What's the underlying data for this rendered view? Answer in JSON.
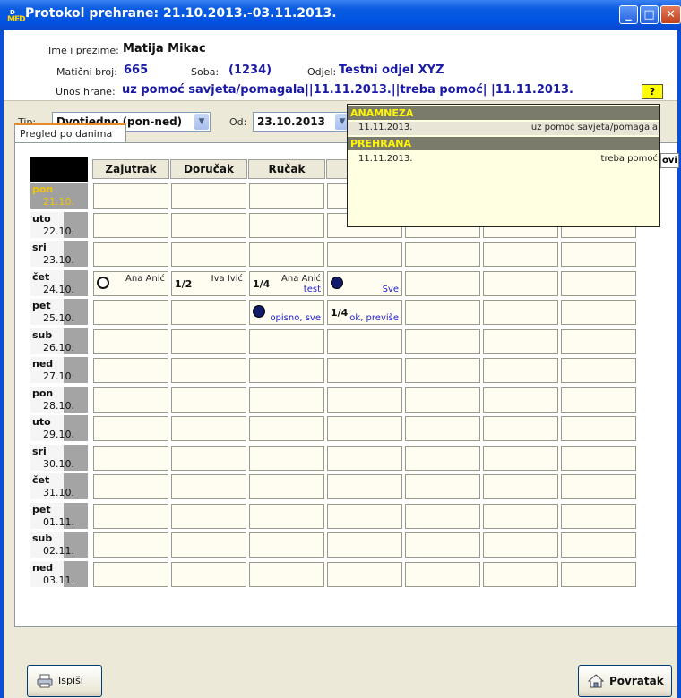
{
  "window": {
    "title": "Protokol prehrane: 21.10.2013.-03.11.2013.",
    "icon_top": "D",
    "icon_bottom": "MED"
  },
  "header": {
    "name_label": "Ime i prezime:",
    "name_value": "Matija Mikac",
    "mbr_label": "Matični broj:",
    "mbr_value": "665",
    "soba_label": "Soba:",
    "soba_value": "(1234)",
    "odjel_label": "Odjel:",
    "odjel_value": "Testni odjel XYZ",
    "unos_label": "Unos hrane:",
    "unos_value": "uz pomoć savjeta/pomagala||11.11.2013.||treba pomoć| |11.11.2013.",
    "help_label": "?"
  },
  "filters": {
    "tip_label": "Tip:",
    "tip_value": "Dvotjedno (pon-ned)",
    "od_label": "Od:",
    "od_value": "23.10.2013"
  },
  "tab": {
    "label": "Pregled po danima"
  },
  "columns": [
    "Zajutrak",
    "Doručak",
    "Ručak",
    "",
    "",
    "",
    ""
  ],
  "days": [
    {
      "name": "pon",
      "date": "21.10.",
      "today": true
    },
    {
      "name": "uto",
      "date": "22.10."
    },
    {
      "name": "sri",
      "date": "23.10."
    },
    {
      "name": "čet",
      "date": "24.10."
    },
    {
      "name": "pet",
      "date": "25.10."
    },
    {
      "name": "sub",
      "date": "26.10."
    },
    {
      "name": "ned",
      "date": "27.10."
    },
    {
      "name": "pon",
      "date": "28.10."
    },
    {
      "name": "uto",
      "date": "29.10."
    },
    {
      "name": "sri",
      "date": "30.10."
    },
    {
      "name": "čet",
      "date": "31.10."
    },
    {
      "name": "pet",
      "date": "01.11."
    },
    {
      "name": "sub",
      "date": "02.11."
    },
    {
      "name": "ned",
      "date": "03.11."
    }
  ],
  "cells": {
    "r3c1": {
      "mark": "empty-circle",
      "who": "Ana Anić"
    },
    "r3c2": {
      "frac": "1/2",
      "who": "Iva Ivić"
    },
    "r3c3": {
      "frac": "1/4",
      "who": "Ana Anić",
      "note": "test"
    },
    "r3c4": {
      "mark": "full-circle",
      "note": "Sve"
    },
    "r4c3": {
      "mark": "full-circle",
      "note": "opisno, sve"
    },
    "r4c4": {
      "frac": "1/4",
      "note": "ok, previše"
    }
  },
  "popup": {
    "section1": "ANAMNEZA",
    "s1_date": "11.11.2013.",
    "s1_text": "uz pomoć savjeta/pomagala",
    "section2": "PREHRANA",
    "s2_date": "11.11.2013.",
    "s2_text": "treba pomoć"
  },
  "peek_label": "ovi",
  "buttons": {
    "print": "Ispiši",
    "back": "Povratak"
  }
}
